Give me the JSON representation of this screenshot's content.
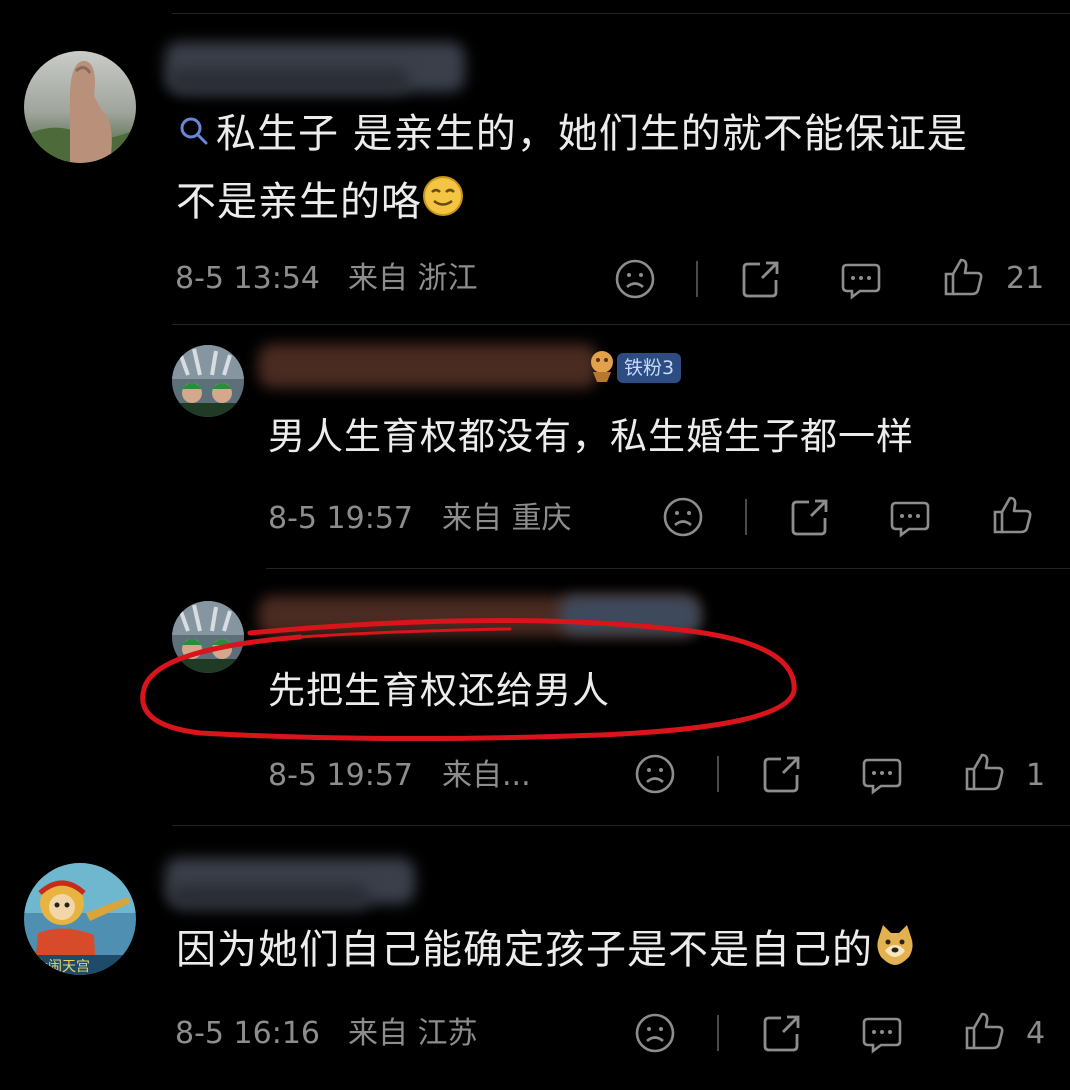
{
  "comments": [
    {
      "search_prefix_icon": "search-icon",
      "text": "私生子 是亲生的，她们生的就不能保证是不是亲生的咯",
      "text_line1": "私生子 是亲生的，她们生的就不能保证是",
      "text_line2": "不是亲生的咯",
      "trailing_emoji": "smile-emoji",
      "timestamp": "8-5 13:54",
      "location": "来自 浙江",
      "like_count": "21"
    },
    {
      "badge": "铁粉3",
      "badge_icon": "fan-badge-icon",
      "text": "男人生育权都没有，私生婚生子都一样",
      "timestamp": "8-5 19:57",
      "location": "来自 重庆",
      "like_count": ""
    },
    {
      "text": "先把生育权还给男人",
      "highlight_color": "#d9141b",
      "timestamp": "8-5 19:57",
      "location": "来自...",
      "like_count": "1"
    },
    {
      "text": "因为她们自己能确定孩子是不是自己的",
      "trailing_emoji": "doge-emoji",
      "timestamp": "8-5 16:16",
      "location": "来自 江苏",
      "like_count": "4"
    }
  ],
  "icons": [
    "sad-face-icon",
    "share-icon",
    "comment-icon",
    "like-icon"
  ]
}
